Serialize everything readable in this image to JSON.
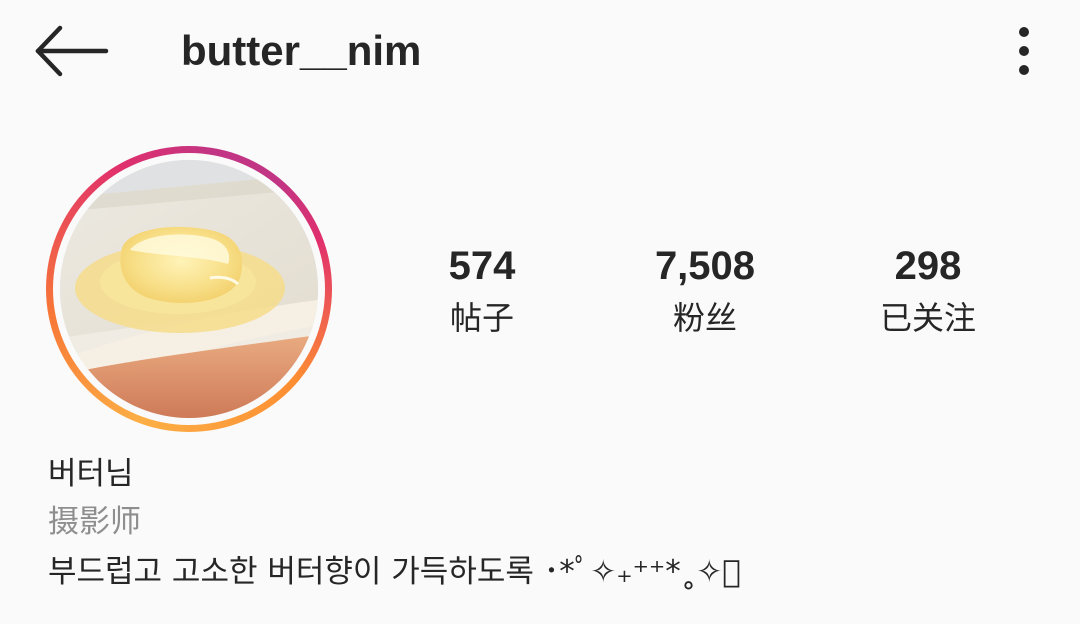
{
  "header": {
    "username": "butter__nim",
    "back_icon": "arrow-left-icon",
    "more_icon": "vertical-ellipsis-icon"
  },
  "profile": {
    "avatar": "butter-on-toast-photo",
    "ring_colors": [
      "#fcaf45",
      "#f77737",
      "#e1306c",
      "#c13584"
    ]
  },
  "stats": {
    "posts": {
      "value": "574",
      "label": "帖子"
    },
    "followers": {
      "value": "7,508",
      "label": "粉丝"
    },
    "following": {
      "value": "298",
      "label": "已关注"
    }
  },
  "bio": {
    "display_name": "버터님",
    "category": "摄影师",
    "text": "부드럽고 고소한 버터향이 가득하도록 ･*ﾟ✧₊⁺⁺*˳✧ﾟ"
  }
}
